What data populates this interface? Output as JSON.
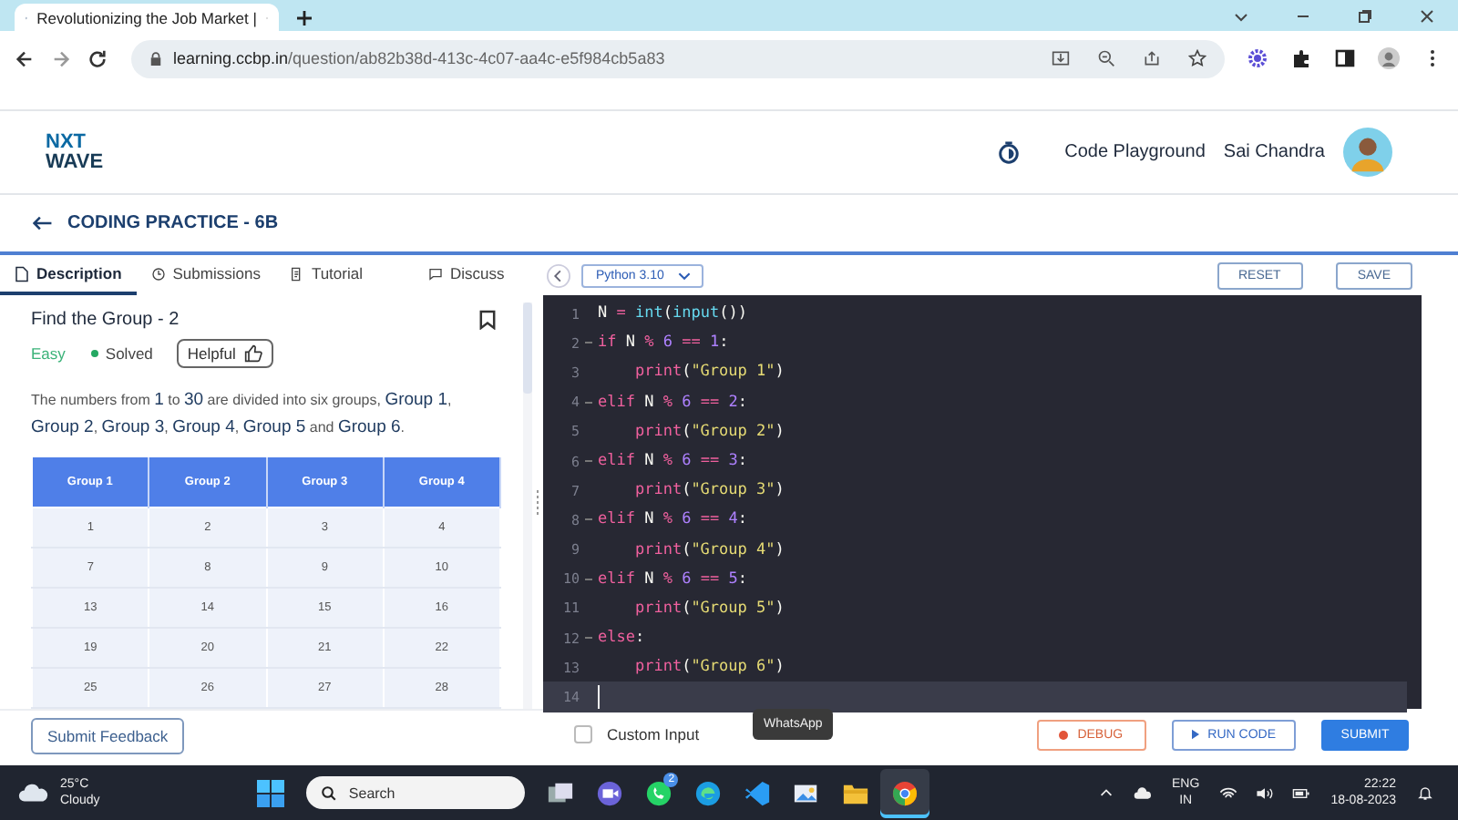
{
  "browser": {
    "tab_title": "Revolutionizing the Job Market |",
    "url_host": "learning.ccbp.in",
    "url_path": "/question/ab82b38d-413c-4c07-aa4c-e5f984cb5a83"
  },
  "header": {
    "logo": [
      "NXT",
      "WAVE"
    ],
    "playground": "Code Playground",
    "user": "Sai Chandra"
  },
  "breadcrumb": "CODING PRACTICE - 6B",
  "tabs": [
    {
      "label": "Description",
      "kind": "doc",
      "selected": true
    },
    {
      "label": "Submissions",
      "kind": "clock",
      "selected": false
    },
    {
      "label": "Tutorial",
      "kind": "note",
      "selected": false
    },
    {
      "label": "Discuss",
      "kind": "chat",
      "selected": false
    }
  ],
  "language": "Python 3.10",
  "editor_buttons": [
    "RESET",
    "SAVE"
  ],
  "problem": {
    "title": "Find the Group - 2",
    "difficulty": "Easy",
    "status": "Solved",
    "helpful": "Helpful",
    "bookmarked": false,
    "text": "The numbers from **1** to **30** are divided into six groups, **Group 1**, **Group 2**, **Group 3**, **Group 4**, **Group 5** and **Group 6**.",
    "table": {
      "columns": [
        "Group 1",
        "Group 2",
        "Group 3",
        "Group 4"
      ],
      "rows": [
        [
          "1",
          "2",
          "3",
          "4"
        ],
        [
          "7",
          "8",
          "9",
          "10"
        ],
        [
          "13",
          "14",
          "15",
          "16"
        ],
        [
          "19",
          "20",
          "21",
          "22"
        ],
        [
          "25",
          "26",
          "27",
          "28"
        ]
      ]
    }
  },
  "code": [
    {
      "n": "1",
      "fold": false,
      "active": false,
      "tokens": [
        {
          "text": "N ",
          "kind": "name"
        },
        {
          "text": "= ",
          "kind": "op"
        },
        {
          "text": "int",
          "kind": "func"
        },
        {
          "text": "(",
          "kind": "punct"
        },
        {
          "text": "input",
          "kind": "func"
        },
        {
          "text": "())",
          "kind": "punct"
        }
      ]
    },
    {
      "n": "2",
      "fold": true,
      "active": false,
      "tokens": [
        {
          "text": "if ",
          "kind": "kw"
        },
        {
          "text": "N ",
          "kind": "name"
        },
        {
          "text": "% ",
          "kind": "op"
        },
        {
          "text": "6 ",
          "kind": "num"
        },
        {
          "text": "== ",
          "kind": "op"
        },
        {
          "text": "1",
          "kind": "num"
        },
        {
          "text": ":",
          "kind": "punct"
        }
      ]
    },
    {
      "n": "3",
      "fold": false,
      "active": false,
      "tokens": [
        {
          "text": "    print",
          "kind": "kw"
        },
        {
          "text": "(",
          "kind": "punct"
        },
        {
          "text": "\"Group 1\"",
          "kind": "str"
        },
        {
          "text": ")",
          "kind": "punct"
        }
      ]
    },
    {
      "n": "4",
      "fold": true,
      "active": false,
      "tokens": [
        {
          "text": "elif ",
          "kind": "kw"
        },
        {
          "text": "N ",
          "kind": "name"
        },
        {
          "text": "% ",
          "kind": "op"
        },
        {
          "text": "6 ",
          "kind": "num"
        },
        {
          "text": "== ",
          "kind": "op"
        },
        {
          "text": "2",
          "kind": "num"
        },
        {
          "text": ":",
          "kind": "punct"
        }
      ]
    },
    {
      "n": "5",
      "fold": false,
      "active": false,
      "tokens": [
        {
          "text": "    print",
          "kind": "kw"
        },
        {
          "text": "(",
          "kind": "punct"
        },
        {
          "text": "\"Group 2\"",
          "kind": "str"
        },
        {
          "text": ")",
          "kind": "punct"
        }
      ]
    },
    {
      "n": "6",
      "fold": true,
      "active": false,
      "tokens": [
        {
          "text": "elif ",
          "kind": "kw"
        },
        {
          "text": "N ",
          "kind": "name"
        },
        {
          "text": "% ",
          "kind": "op"
        },
        {
          "text": "6 ",
          "kind": "num"
        },
        {
          "text": "== ",
          "kind": "op"
        },
        {
          "text": "3",
          "kind": "num"
        },
        {
          "text": ":",
          "kind": "punct"
        }
      ]
    },
    {
      "n": "7",
      "fold": false,
      "active": false,
      "tokens": [
        {
          "text": "    print",
          "kind": "kw"
        },
        {
          "text": "(",
          "kind": "punct"
        },
        {
          "text": "\"Group 3\"",
          "kind": "str"
        },
        {
          "text": ")",
          "kind": "punct"
        }
      ]
    },
    {
      "n": "8",
      "fold": true,
      "active": false,
      "tokens": [
        {
          "text": "elif ",
          "kind": "kw"
        },
        {
          "text": "N ",
          "kind": "name"
        },
        {
          "text": "% ",
          "kind": "op"
        },
        {
          "text": "6 ",
          "kind": "num"
        },
        {
          "text": "== ",
          "kind": "op"
        },
        {
          "text": "4",
          "kind": "num"
        },
        {
          "text": ":",
          "kind": "punct"
        }
      ]
    },
    {
      "n": "9",
      "fold": false,
      "active": false,
      "tokens": [
        {
          "text": "    print",
          "kind": "kw"
        },
        {
          "text": "(",
          "kind": "punct"
        },
        {
          "text": "\"Group 4\"",
          "kind": "str"
        },
        {
          "text": ")",
          "kind": "punct"
        }
      ]
    },
    {
      "n": "10",
      "fold": true,
      "active": false,
      "tokens": [
        {
          "text": "elif ",
          "kind": "kw"
        },
        {
          "text": "N ",
          "kind": "name"
        },
        {
          "text": "% ",
          "kind": "op"
        },
        {
          "text": "6 ",
          "kind": "num"
        },
        {
          "text": "== ",
          "kind": "op"
        },
        {
          "text": "5",
          "kind": "num"
        },
        {
          "text": ":",
          "kind": "punct"
        }
      ]
    },
    {
      "n": "11",
      "fold": false,
      "active": false,
      "tokens": [
        {
          "text": "    print",
          "kind": "kw"
        },
        {
          "text": "(",
          "kind": "punct"
        },
        {
          "text": "\"Group 5\"",
          "kind": "str"
        },
        {
          "text": ")",
          "kind": "punct"
        }
      ]
    },
    {
      "n": "12",
      "fold": true,
      "active": false,
      "tokens": [
        {
          "text": "else",
          "kind": "kw"
        },
        {
          "text": ":",
          "kind": "punct"
        }
      ]
    },
    {
      "n": "13",
      "fold": false,
      "active": false,
      "tokens": [
        {
          "text": "    print",
          "kind": "kw"
        },
        {
          "text": "(",
          "kind": "punct"
        },
        {
          "text": "\"Group 6\"",
          "kind": "str"
        },
        {
          "text": ")",
          "kind": "punct"
        }
      ]
    },
    {
      "n": "14",
      "fold": false,
      "active": true
    }
  ],
  "footer": {
    "feedback": "Submit Feedback",
    "custom_input": {
      "label": "Custom Input",
      "checked": false
    },
    "debug": "DEBUG",
    "run": "RUN CODE",
    "submit": "SUBMIT",
    "tooltip": "WhatsApp"
  },
  "taskbar": {
    "temp": "25°C",
    "weather": "Cloudy",
    "search": "Search",
    "apps": [
      {
        "kind": "taskview",
        "selected": false
      },
      {
        "kind": "meet",
        "selected": false
      },
      {
        "kind": "whatsapp",
        "badge": "2",
        "selected": false
      },
      {
        "kind": "edge",
        "selected": false
      },
      {
        "kind": "vscode",
        "selected": false
      },
      {
        "kind": "photos",
        "selected": false
      },
      {
        "kind": "files",
        "selected": false
      },
      {
        "kind": "chrome",
        "selected": true
      }
    ],
    "lang": "ENG",
    "region": "IN",
    "time": "22:22",
    "date": "18-08-2023"
  }
}
